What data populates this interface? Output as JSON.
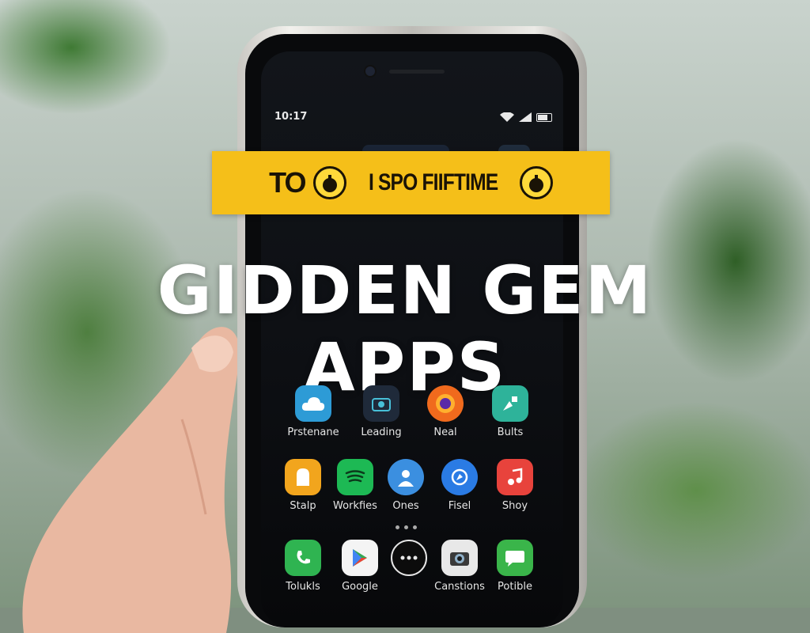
{
  "status_bar": {
    "time": "10:17"
  },
  "banner": {
    "left_word": "TO",
    "text": "I SPO FIIFTIME"
  },
  "headline": {
    "line1": "GIDDEN GEM",
    "line2": "APPS"
  },
  "apps_row1": [
    {
      "label": "Prstenane",
      "icon": "cloud-icon",
      "color": "#2d9bd6"
    },
    {
      "label": "Leading",
      "icon": "camera-icon",
      "color": "#1f2a3a"
    },
    {
      "label": "Neal",
      "icon": "firefox-icon",
      "color": "#f06a1d"
    },
    {
      "label": "Bults",
      "icon": "shapes-icon",
      "color": "#2eb39a"
    }
  ],
  "apps_row2": [
    {
      "label": "Stalp",
      "icon": "ghost-icon",
      "color": "#f2a51d"
    },
    {
      "label": "Workfies",
      "icon": "spotify-icon",
      "color": "#1db954"
    },
    {
      "label": "Ones",
      "icon": "person-icon",
      "color": "#3b8fe0"
    },
    {
      "label": "Fisel",
      "icon": "compass-icon",
      "color": "#2a7be4"
    },
    {
      "label": "Shoy",
      "icon": "music-icon",
      "color": "#e8433c"
    }
  ],
  "apps_row3": [
    {
      "label": "Tolukls",
      "icon": "phone-icon",
      "color": "#2fb451"
    },
    {
      "label": "Google",
      "icon": "play-store-icon",
      "color": "#f4f4f4"
    },
    {
      "label": "",
      "icon": "more-apps-icon",
      "color": "#0c0c0c"
    },
    {
      "label": "Canstions",
      "icon": "camera-icon",
      "color": "#e8e8e8"
    },
    {
      "label": "Potible",
      "icon": "chat-icon",
      "color": "#3ab54a"
    }
  ]
}
